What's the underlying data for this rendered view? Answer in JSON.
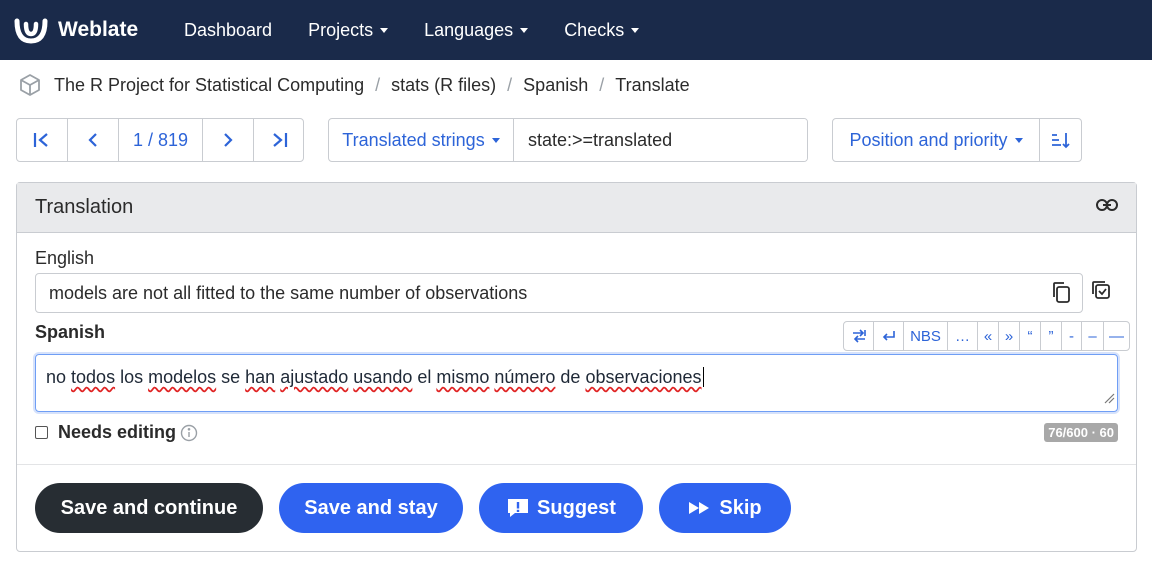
{
  "navbar": {
    "brand": "Weblate",
    "items": [
      {
        "label": "Dashboard",
        "dropdown": false
      },
      {
        "label": "Projects",
        "dropdown": true
      },
      {
        "label": "Languages",
        "dropdown": true
      },
      {
        "label": "Checks",
        "dropdown": true
      }
    ]
  },
  "breadcrumb": [
    "The R Project for Statistical Computing",
    "stats (R files)",
    "Spanish",
    "Translate"
  ],
  "navigation": {
    "position": "1 / 819"
  },
  "filter": {
    "dropdown_label": "Translated strings",
    "query": "state:>=translated"
  },
  "sort": {
    "label": "Position and priority"
  },
  "panel": {
    "title": "Translation",
    "source_label": "English",
    "source_text": "models are not all fitted to the same number of observations",
    "target_label": "Spanish",
    "target_words": [
      {
        "t": "no ",
        "err": false
      },
      {
        "t": "todos",
        "err": true
      },
      {
        "t": " los ",
        "err": false
      },
      {
        "t": "modelos",
        "err": true
      },
      {
        "t": " se ",
        "err": false
      },
      {
        "t": "han",
        "err": true
      },
      {
        "t": " ",
        "err": false
      },
      {
        "t": "ajustado",
        "err": true
      },
      {
        "t": " ",
        "err": false
      },
      {
        "t": "usando",
        "err": true
      },
      {
        "t": " el ",
        "err": false
      },
      {
        "t": "mismo",
        "err": true
      },
      {
        "t": " ",
        "err": false
      },
      {
        "t": "número",
        "err": true
      },
      {
        "t": " de ",
        "err": false
      },
      {
        "t": "observaciones",
        "err": true
      }
    ],
    "special_chars": [
      "NBS",
      "…",
      "«",
      "»",
      "“",
      "”",
      "-",
      "–",
      "—"
    ],
    "needs_editing_label": "Needs editing",
    "counter": "76/600 · 60"
  },
  "actions": {
    "save_continue": "Save and continue",
    "save_stay": "Save and stay",
    "suggest": "Suggest",
    "skip": "Skip"
  },
  "colors": {
    "navbar": "#1a2a4a",
    "link": "#2d64d8",
    "primary": "#2f63f0",
    "dark": "#272d33"
  }
}
